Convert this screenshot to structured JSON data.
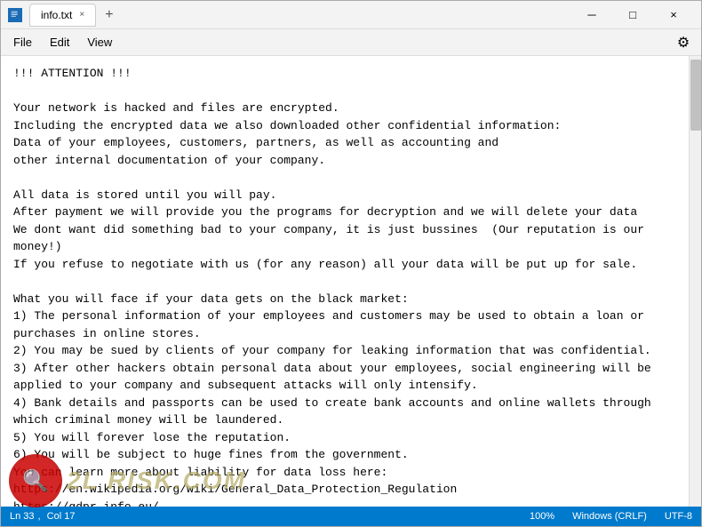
{
  "window": {
    "title": "info.txt",
    "icon": "notepad"
  },
  "titlebar": {
    "tab_label": "info.txt",
    "close_symbol": "×",
    "add_symbol": "+",
    "minimize_symbol": "─",
    "maximize_symbol": "□",
    "window_close_symbol": "×"
  },
  "menu": {
    "items": [
      "File",
      "Edit",
      "View"
    ],
    "settings_icon": "⚙"
  },
  "content": {
    "text": "!!! ATTENTION !!!\n\nYour network is hacked and files are encrypted.\nIncluding the encrypted data we also downloaded other confidential information:\nData of your employees, customers, partners, as well as accounting and\nother internal documentation of your company.\n\nAll data is stored until you will pay.\nAfter payment we will provide you the programs for decryption and we will delete your data\nWe dont want did something bad to your company, it is just bussines  (Our reputation is our money!)\nIf you refuse to negotiate with us (for any reason) all your data will be put up for sale.\n\nWhat you will face if your data gets on the black market:\n1) The personal information of your employees and customers may be used to obtain a loan or\npurchases in online stores.\n2) You may be sued by clients of your company for leaking information that was confidential.\n3) After other hackers obtain personal data about your employees, social engineering will be\napplied to your company and subsequent attacks will only intensify.\n4) Bank details and passports can be used to create bank accounts and online wallets through\nwhich criminal money will be laundered.\n5) You will forever lose the reputation.\n6) You will be subject to huge fines from the government.\nYou can learn more about liability for data loss here:\nhttps://en.wikipedia.org/wiki/General_Data_Protection_Regulation\nhttps://gdpr-info.eu/\n\n..., fines and the inability to use important files will lead you to huge losses.\n...nsequences of this will be irreversible for you.\n...ting the police will not save you from these consequences, and lost data,"
  },
  "statusbar": {
    "line": "Ln 33",
    "col": "Col 17",
    "zoom": "100%",
    "line_ending": "Windows (CRLF)",
    "encoding": "UTF-8"
  },
  "watermark": {
    "logo_text": "🔍",
    "text": "2L RISK.COM"
  }
}
